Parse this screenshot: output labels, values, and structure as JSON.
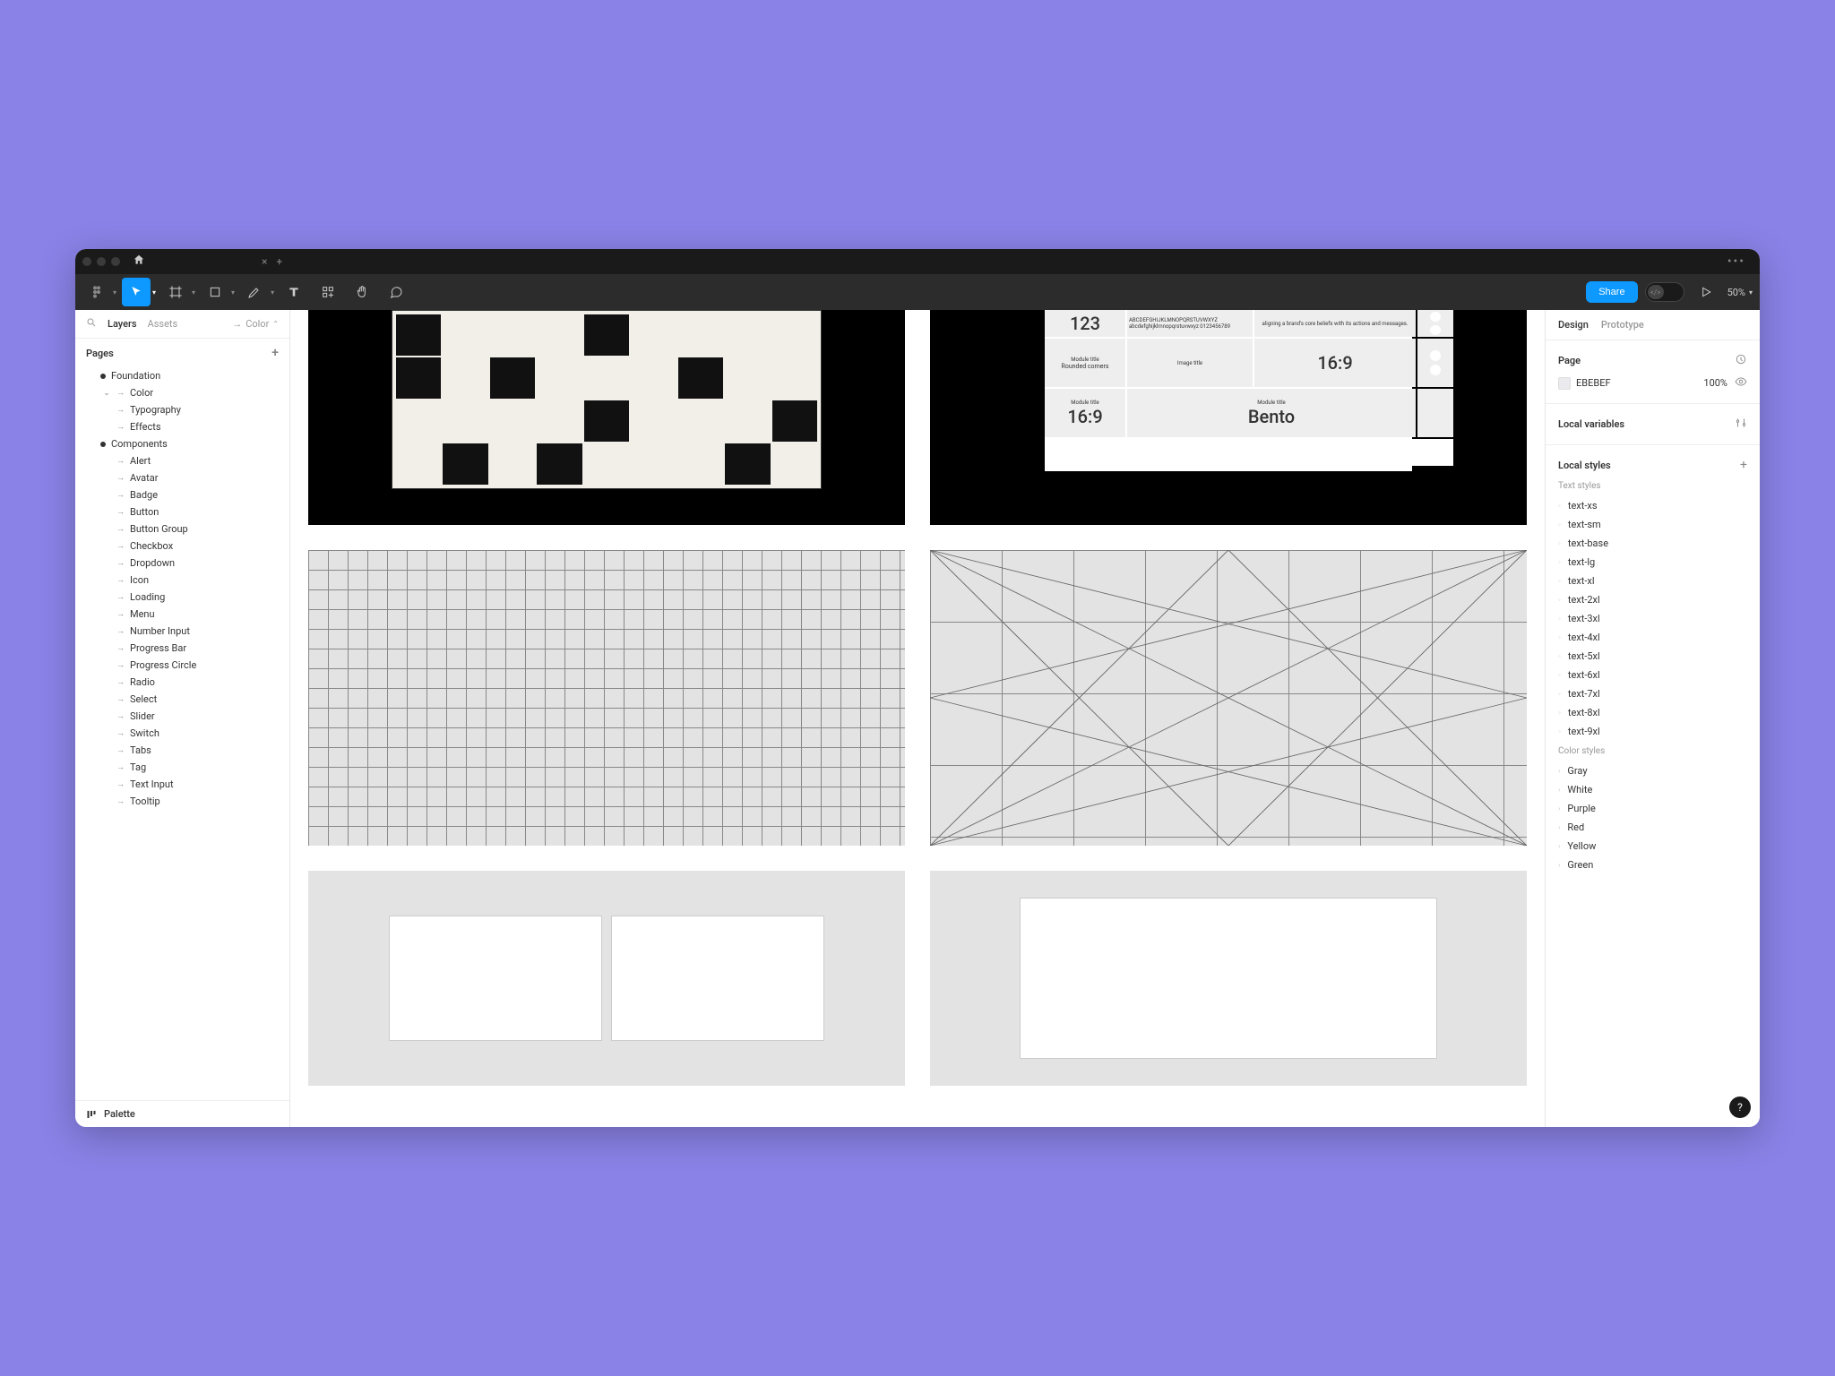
{
  "titlebar": {
    "tab_close": "×",
    "tab_add": "+"
  },
  "toolbar": {
    "share_label": "Share",
    "zoom": "50%"
  },
  "left_panel": {
    "tabs": {
      "layers": "Layers",
      "assets": "Assets",
      "right": "Color"
    },
    "pages_label": "Pages",
    "pages": [
      {
        "name": "Foundation",
        "bullet": true
      },
      {
        "name": "Color",
        "indent": 1,
        "expanded": true
      },
      {
        "name": "Typography",
        "indent": 1
      },
      {
        "name": "Effects",
        "indent": 1
      },
      {
        "name": "Components",
        "bullet": true
      },
      {
        "name": "Alert",
        "indent": 1
      },
      {
        "name": "Avatar",
        "indent": 1
      },
      {
        "name": "Badge",
        "indent": 1
      },
      {
        "name": "Button",
        "indent": 1
      },
      {
        "name": "Button Group",
        "indent": 1
      },
      {
        "name": "Checkbox",
        "indent": 1
      },
      {
        "name": "Dropdown",
        "indent": 1
      },
      {
        "name": "Icon",
        "indent": 1
      },
      {
        "name": "Loading",
        "indent": 1
      },
      {
        "name": "Menu",
        "indent": 1
      },
      {
        "name": "Number Input",
        "indent": 1
      },
      {
        "name": "Progress Bar",
        "indent": 1
      },
      {
        "name": "Progress Circle",
        "indent": 1
      },
      {
        "name": "Radio",
        "indent": 1
      },
      {
        "name": "Select",
        "indent": 1
      },
      {
        "name": "Slider",
        "indent": 1
      },
      {
        "name": "Switch",
        "indent": 1
      },
      {
        "name": "Tabs",
        "indent": 1
      },
      {
        "name": "Tag",
        "indent": 1
      },
      {
        "name": "Text Input",
        "indent": 1
      },
      {
        "name": "Tooltip",
        "indent": 1
      }
    ],
    "footer": "Palette"
  },
  "canvas": {
    "bento": {
      "tl_num": "123",
      "tl_lorem": "ABCDEFGHIJKLMNOPQRSTUVWXYZ abcdefghijklmnopqrstuvwxyz 0123456789",
      "tr_text": "aligning a brand's core beliefs with its actions and messages.",
      "mod_label": "Module title",
      "img_label": "Image title",
      "rounded": "Rounded corners",
      "ratio_a": "16:9",
      "ratio_b": "16:9",
      "bento_label": "Bento"
    }
  },
  "right_panel": {
    "tabs": {
      "design": "Design",
      "prototype": "Prototype"
    },
    "page_section": "Page",
    "bg_hex": "EBEBEF",
    "bg_opacity": "100%",
    "local_variables": "Local variables",
    "local_styles": "Local styles",
    "text_styles_label": "Text styles",
    "text_styles": [
      "text-xs",
      "text-sm",
      "text-base",
      "text-lg",
      "text-xl",
      "text-2xl",
      "text-3xl",
      "text-4xl",
      "text-5xl",
      "text-6xl",
      "text-7xl",
      "text-8xl",
      "text-9xl"
    ],
    "color_styles_label": "Color styles",
    "color_styles": [
      "Gray",
      "White",
      "Purple",
      "Red",
      "Yellow",
      "Green"
    ]
  }
}
